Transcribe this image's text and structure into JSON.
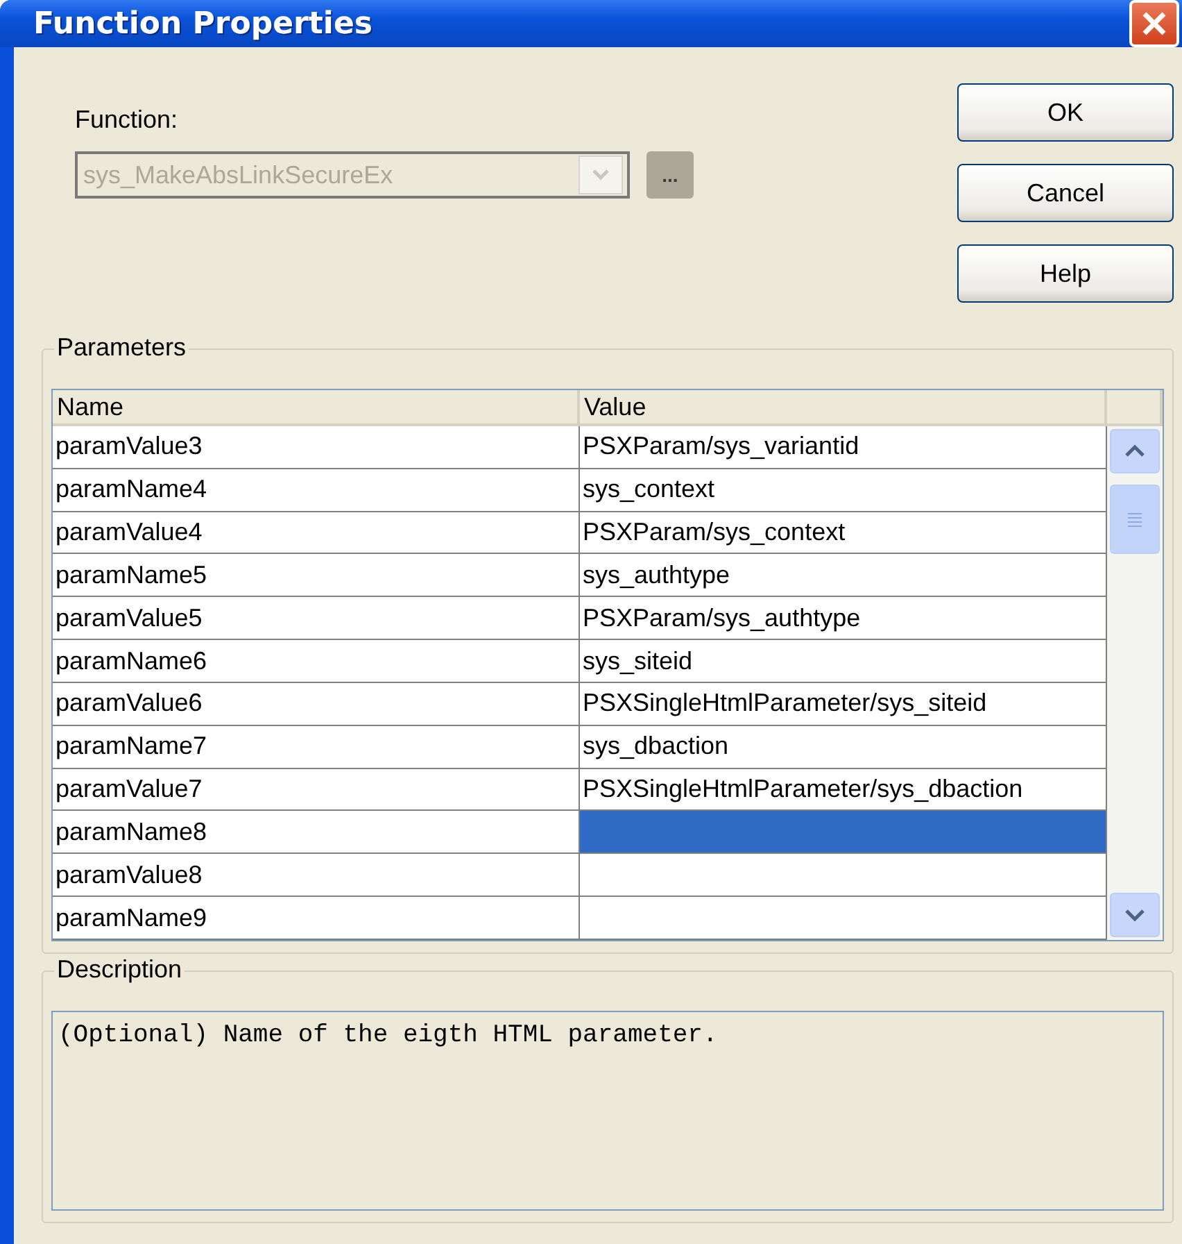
{
  "window": {
    "title": "Function Properties"
  },
  "function": {
    "label": "Function:",
    "value": "sys_MakeAbsLinkSecureEx",
    "disabled": true,
    "browse_label": "..."
  },
  "buttons": [
    "OK",
    "Cancel",
    "Help"
  ],
  "parameters": {
    "title": "Parameters",
    "columns": [
      "Name",
      "Value"
    ],
    "rows": [
      {
        "name": "paramValue3",
        "value": "PSXParam/sys_variantid",
        "selected": false
      },
      {
        "name": "paramName4",
        "value": "sys_context",
        "selected": false
      },
      {
        "name": "paramValue4",
        "value": "PSXParam/sys_context",
        "selected": false
      },
      {
        "name": "paramName5",
        "value": "sys_authtype",
        "selected": false
      },
      {
        "name": "paramValue5",
        "value": "PSXParam/sys_authtype",
        "selected": false
      },
      {
        "name": "paramName6",
        "value": "sys_siteid",
        "selected": false
      },
      {
        "name": "paramValue6",
        "value": "PSXSingleHtmlParameter/sys_siteid",
        "selected": false
      },
      {
        "name": "paramName7",
        "value": "sys_dbaction",
        "selected": false
      },
      {
        "name": "paramValue7",
        "value": "PSXSingleHtmlParameter/sys_dbaction",
        "selected": false
      },
      {
        "name": "paramName8",
        "value": "",
        "selected": true
      },
      {
        "name": "paramValue8",
        "value": "",
        "selected": false
      },
      {
        "name": "paramName9",
        "value": "",
        "selected": false
      }
    ]
  },
  "description": {
    "title": "Description",
    "text": "(Optional) Name of the eigth HTML parameter."
  }
}
